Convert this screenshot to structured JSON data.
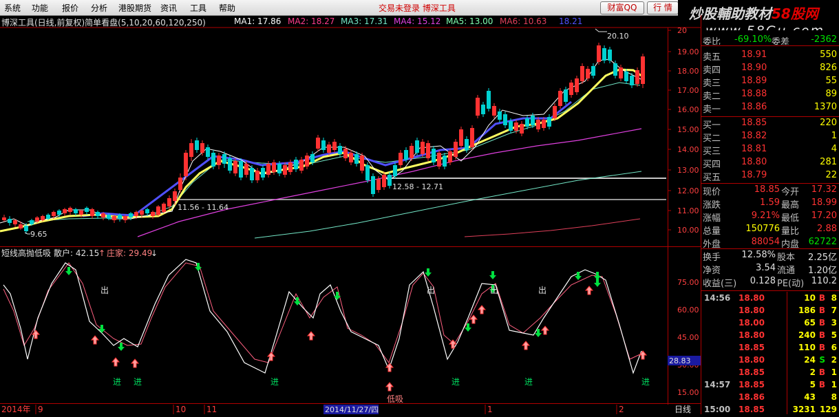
{
  "menu": {
    "items": [
      "系统",
      "功能",
      "报价",
      "分析",
      "港股期货",
      "资讯",
      "工具",
      "帮助"
    ],
    "center_note": "交易未登录   博深工具",
    "caifu_button": "财富QQ",
    "hangqing_button": "行 情"
  },
  "watermark": {
    "line1_a": "炒股輔助教材",
    "line1_b": "58股网",
    "line2": "www.58Gu.com"
  },
  "chart_title": "博深工具(日线,前复权)简单看盘(5,10,20,60,120,250)",
  "ma_labels": [
    {
      "name": "MA1: 17.86",
      "color": "#ffffff"
    },
    {
      "name": "MA2: 18.27",
      "color": "#ff3c8c"
    },
    {
      "name": "MA3: 17.31",
      "color": "#74e8c8"
    },
    {
      "name": "MA4: 15.12",
      "color": "#e040e0"
    },
    {
      "name": "MA5: 13.00",
      "color": "#80ffb0"
    },
    {
      "name": "MA6: 10.63",
      "color": "#e0405a"
    },
    {
      "name": "18.21",
      "color": "#5050ff"
    }
  ],
  "price_axis": [
    "20",
    "19.00",
    "18.00",
    "17.00",
    "16.00",
    "15.00",
    "14.00",
    "13.00",
    "12.00",
    "11.00",
    "10.00"
  ],
  "annotations": {
    "high": "20.10",
    "low": "9.65",
    "zone1": "12.58 - 12.71",
    "zone2": "11.56 - 11.64"
  },
  "indicator_title": {
    "name": "短线高抛低吸",
    "retail": "散户: 42.15",
    "banker": "庄家: 29.49"
  },
  "indicator_axis": [
    "75.00",
    "60.00",
    "45.00",
    "30.00",
    "15.00"
  ],
  "indicator_current": "28.83",
  "signal_labels": {
    "out": "出",
    "in": "进",
    "low_buy": "低吸"
  },
  "date_axis": {
    "year": "2014年",
    "m9": "9",
    "m10": "10",
    "m11": "11",
    "cursor_date": "2014/11/27/四",
    "m1": "1",
    "m2": "2",
    "period": "日线"
  },
  "quote": {
    "weibi_label": "委比",
    "weibi_value": "-69.10%",
    "weicha_label": "委差",
    "weicha_value": "-2362",
    "asks": [
      {
        "label": "卖五",
        "price": "18.91",
        "vol": "550"
      },
      {
        "label": "卖四",
        "price": "18.90",
        "vol": "826"
      },
      {
        "label": "卖三",
        "price": "18.89",
        "vol": "55"
      },
      {
        "label": "卖二",
        "price": "18.88",
        "vol": "89"
      },
      {
        "label": "卖一",
        "price": "18.86",
        "vol": "1370"
      }
    ],
    "bids": [
      {
        "label": "买一",
        "price": "18.85",
        "vol": "220"
      },
      {
        "label": "买二",
        "price": "18.82",
        "vol": "1"
      },
      {
        "label": "买三",
        "price": "18.81",
        "vol": "4"
      },
      {
        "label": "买四",
        "price": "18.80",
        "vol": "281"
      },
      {
        "label": "买五",
        "price": "18.79",
        "vol": "22"
      }
    ],
    "stats": [
      {
        "l1": "现价",
        "v1": "18.85",
        "l2": "今开",
        "v2": "17.32",
        "c1": "#ff3232",
        "c2": "#ff3232"
      },
      {
        "l1": "涨跌",
        "v1": "1.59",
        "l2": "最高",
        "v2": "18.99",
        "c1": "#ff3232",
        "c2": "#ff3232"
      },
      {
        "l1": "涨幅",
        "v1": "9.21%",
        "l2": "最低",
        "v2": "17.20",
        "c1": "#ff3232",
        "c2": "#ff3232"
      },
      {
        "l1": "总量",
        "v1": "150776",
        "l2": "量比",
        "v2": "2.88",
        "c1": "#ffff00",
        "c2": "#ff3232"
      },
      {
        "l1": "外盘",
        "v1": "88054",
        "l2": "内盘",
        "v2": "62722",
        "c1": "#ff3232",
        "c2": "#00e000"
      }
    ],
    "stats2": [
      {
        "l1": "换手",
        "v1": "12.58%",
        "l2": "股本",
        "v2": "2.25亿"
      },
      {
        "l1": "净资",
        "v1": "3.54",
        "l2": "流通",
        "v2": "1.20亿"
      },
      {
        "l1": "收益(三)",
        "v1": "0.128",
        "l2": "PE(动)",
        "v2": "110.2"
      }
    ],
    "ticks": [
      {
        "time": "14:56",
        "price": "18.80",
        "vol": "10",
        "flag": "B",
        "mark": "8"
      },
      {
        "time": "",
        "price": "18.80",
        "vol": "186",
        "flag": "B",
        "mark": "7"
      },
      {
        "time": "",
        "price": "18.00",
        "vol": "65",
        "flag": "B",
        "mark": "3"
      },
      {
        "time": "",
        "price": "18.80",
        "vol": "240",
        "flag": "B",
        "mark": "5"
      },
      {
        "time": "",
        "price": "18.85",
        "vol": "110",
        "flag": "B",
        "mark": "6"
      },
      {
        "time": "",
        "price": "18.80",
        "vol": "24",
        "flag": "S",
        "mark": "2"
      },
      {
        "time": "",
        "price": "18.85",
        "vol": "2",
        "flag": "B",
        "mark": "1"
      },
      {
        "time": "14:57",
        "price": "18.85",
        "vol": "5",
        "flag": "B",
        "mark": "1"
      },
      {
        "time": "",
        "price": "18.86",
        "vol": "43",
        "flag": "",
        "mark": "8"
      },
      {
        "time": "15:00",
        "price": "18.85",
        "vol": "3231",
        "flag": "",
        "mark": "129"
      }
    ]
  },
  "colors": {
    "up": "#ff3232",
    "down": "#00e0e0",
    "bg": "#000000",
    "axis": "#b00000"
  }
}
